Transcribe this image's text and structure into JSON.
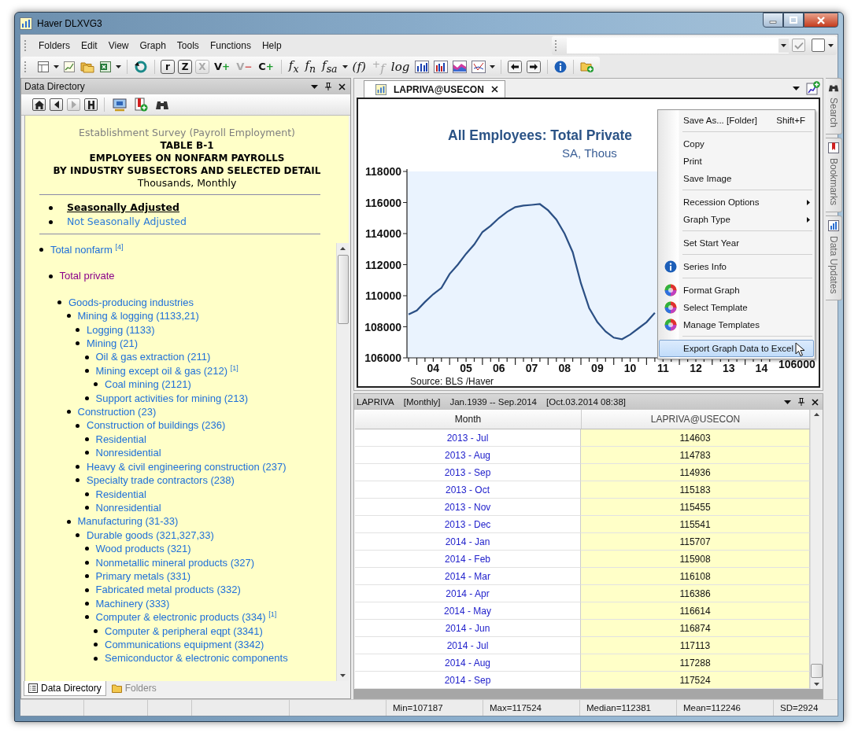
{
  "window": {
    "title": "Haver DLXVG3"
  },
  "menu": [
    "Folders",
    "Edit",
    "View",
    "Graph",
    "Tools",
    "Functions",
    "Help"
  ],
  "toolbar": {
    "glyph_buttons": [
      {
        "kind": "boxed",
        "label": "r",
        "disabled": false,
        "dropdown": false
      },
      {
        "kind": "boxed",
        "label": "Z",
        "disabled": false,
        "dropdown": false
      },
      {
        "kind": "boxed",
        "label": "X",
        "disabled": true,
        "dropdown": false
      },
      {
        "kind": "sign",
        "label": "V",
        "sign": "+",
        "disabled": false,
        "dropdown": false
      },
      {
        "kind": "sign",
        "label": "V",
        "sign": "−",
        "disabled": true,
        "dropdown": false
      },
      {
        "kind": "sign",
        "label": "C",
        "sign": "+",
        "disabled": false,
        "dropdown": false
      },
      {
        "kind": "italic",
        "label": "f$_{x}$",
        "disabled": false,
        "dropdown": false
      },
      {
        "kind": "italic",
        "label": "f$_{n}$",
        "disabled": false,
        "dropdown": false
      },
      {
        "kind": "italic",
        "label": "f$_{sa}$",
        "disabled": false,
        "dropdown": true
      },
      {
        "kind": "italic",
        "label": "(f)",
        "disabled": false,
        "dropdown": false
      },
      {
        "kind": "italic",
        "label": "$^{+}$f",
        "disabled": true,
        "dropdown": false
      },
      {
        "kind": "italic",
        "label": "log",
        "disabled": false,
        "dropdown": false
      }
    ]
  },
  "left_panel": {
    "title": "Data Directory",
    "heading": {
      "survey": "Establishment Survey (Payroll Employment)",
      "table": "TABLE B-1",
      "lines": [
        "EMPLOYEES ON NONFARM PAYROLLS",
        "BY INDUSTRY SUBSECTORS AND SELECTED DETAIL"
      ],
      "units": "Thousands, Monthly"
    },
    "adjustment_links": [
      {
        "label": "Seasonally Adjusted",
        "selected": true
      },
      {
        "label": "Not Seasonally Adjusted",
        "selected": false
      }
    ],
    "tree": [
      {
        "label": "Total nonfarm $^{[4]}$",
        "visited": false,
        "children": [
          {
            "label": "Total private",
            "visited": true,
            "children": [
              {
                "label": "Goods-producing industries",
                "visited": false,
                "children": [
                  {
                    "label": "Mining & logging (1133,21)",
                    "visited": false,
                    "children": [
                      {
                        "label": "Logging (1133)",
                        "visited": false
                      },
                      {
                        "label": "Mining (21)",
                        "visited": false,
                        "children": [
                          {
                            "label": "Oil & gas extraction (211)",
                            "visited": false
                          },
                          {
                            "label": "Mining except oil & gas (212) $^{[1]}$",
                            "visited": false,
                            "children": [
                              {
                                "label": "Coal mining (2121)",
                                "visited": false
                              }
                            ]
                          },
                          {
                            "label": "Support activities for mining (213)",
                            "visited": false
                          }
                        ]
                      }
                    ]
                  },
                  {
                    "label": "Construction (23)",
                    "visited": false,
                    "children": [
                      {
                        "label": "Construction of buildings (236)",
                        "visited": false,
                        "children": [
                          {
                            "label": "Residential",
                            "visited": false
                          },
                          {
                            "label": "Nonresidential",
                            "visited": false
                          }
                        ]
                      },
                      {
                        "label": "Heavy & civil engineering construction (237)",
                        "visited": false
                      },
                      {
                        "label": "Specialty trade contractors (238)",
                        "visited": false,
                        "children": [
                          {
                            "label": "Residential",
                            "visited": false
                          },
                          {
                            "label": "Nonresidential",
                            "visited": false
                          }
                        ]
                      }
                    ]
                  },
                  {
                    "label": "Manufacturing (31-33)",
                    "visited": false,
                    "children": [
                      {
                        "label": "Durable goods (321,327,33)",
                        "visited": false,
                        "children": [
                          {
                            "label": "Wood products (321)",
                            "visited": false
                          },
                          {
                            "label": "Nonmetallic mineral products (327)",
                            "visited": false
                          },
                          {
                            "label": "Primary metals (331)",
                            "visited": false
                          },
                          {
                            "label": "Fabricated metal products (332)",
                            "visited": false
                          },
                          {
                            "label": "Machinery (333)",
                            "visited": false
                          },
                          {
                            "label": "Computer & electronic products (334) $^{[1]}$",
                            "visited": false,
                            "children": [
                              {
                                "label": "Computer & peripheral eqpt (3341)",
                                "visited": false
                              },
                              {
                                "label": "Communications equipment (3342)",
                                "visited": false
                              },
                              {
                                "label": "Semiconductor & electronic components",
                                "visited": false
                              }
                            ]
                          }
                        ]
                      }
                    ]
                  }
                ]
              }
            ]
          }
        ]
      }
    ],
    "bottom_tabs": [
      {
        "label": "Data Directory",
        "selected": true
      },
      {
        "label": "Folders",
        "selected": false
      }
    ]
  },
  "graph_panel": {
    "tab": "LAPRIVA@USECON",
    "title": "All Employees: Total Private",
    "subtitle": "SA, Thous",
    "source": "Source: BLS /Haver",
    "right_ytick": "106000",
    "chart_data": {
      "type": "line",
      "x": [
        3.25,
        3.5,
        3.75,
        4.0,
        4.25,
        4.5,
        4.75,
        5.0,
        5.25,
        5.5,
        5.75,
        6.0,
        6.25,
        6.5,
        6.75,
        7.0,
        7.25,
        7.5,
        7.75,
        8.0,
        8.25,
        8.5,
        8.75,
        9.0,
        9.25,
        9.5,
        9.75,
        10.0,
        10.25,
        10.5,
        10.75
      ],
      "series": [
        {
          "color": "#2b4f84",
          "values": [
            108800,
            109050,
            109600,
            110100,
            110500,
            111400,
            112000,
            112700,
            113300,
            114100,
            114500,
            115000,
            115400,
            115700,
            115800,
            115850,
            115900,
            115500,
            114900,
            114000,
            112800,
            110800,
            109200,
            108300,
            107700,
            107300,
            107200,
            107500,
            107900,
            108300,
            108900
          ]
        }
      ],
      "xlim": [
        3.2,
        14.35
      ],
      "ylim": [
        106000,
        118000
      ],
      "xticks": [
        {
          "value": 4,
          "label": "04"
        },
        {
          "value": 5,
          "label": "05"
        },
        {
          "value": 6,
          "label": "06"
        },
        {
          "value": 7,
          "label": "07"
        },
        {
          "value": 8,
          "label": "08"
        },
        {
          "value": 9,
          "label": "09"
        },
        {
          "value": 10,
          "label": "10"
        },
        {
          "value": 11,
          "label": "11"
        },
        {
          "value": 12,
          "label": "12"
        },
        {
          "value": 13,
          "label": "13"
        },
        {
          "value": 14,
          "label": "14"
        }
      ],
      "yticks": [
        106000,
        108000,
        110000,
        112000,
        114000,
        116000,
        118000
      ]
    }
  },
  "context_menu": [
    {
      "kind": "plain",
      "label": "Save As... [Folder]",
      "shortcut": "Shift+F",
      "submenu": false,
      "selected": false
    },
    {
      "kind": "separator"
    },
    {
      "kind": "plain",
      "label": "Copy",
      "submenu": false,
      "selected": false
    },
    {
      "kind": "plain",
      "label": "Print",
      "submenu": false,
      "selected": false
    },
    {
      "kind": "plain",
      "label": "Save Image",
      "submenu": false,
      "selected": false
    },
    {
      "kind": "separator"
    },
    {
      "kind": "plain",
      "label": "Recession Options",
      "submenu": true,
      "selected": false
    },
    {
      "kind": "plain",
      "label": "Graph Type",
      "submenu": true,
      "selected": false
    },
    {
      "kind": "separator"
    },
    {
      "kind": "plain",
      "label": "Set Start Year",
      "submenu": false,
      "selected": false
    },
    {
      "kind": "separator"
    },
    {
      "kind": "info",
      "label": "Series Info",
      "submenu": false,
      "selected": false
    },
    {
      "kind": "separator"
    },
    {
      "kind": "palette",
      "label": "Format Graph",
      "submenu": false,
      "selected": false
    },
    {
      "kind": "palette",
      "label": "Select Template",
      "submenu": false,
      "selected": false
    },
    {
      "kind": "palette",
      "label": "Manage Templates",
      "submenu": false,
      "selected": false
    },
    {
      "kind": "separator"
    },
    {
      "kind": "plain",
      "label": "Export Graph Data to Excel",
      "submenu": false,
      "selected": true
    }
  ],
  "table_panel": {
    "header": {
      "series": "LAPRIVA",
      "frequency": "[Monthly]",
      "range": "Jan.1939 -- Sep.2014",
      "updated": "[Oct.03.2014 08:38]"
    },
    "columns": [
      "Month",
      "LAPRIVA@USECON"
    ],
    "rows": [
      [
        "2013 - Jul",
        "114603"
      ],
      [
        "2013 - Aug",
        "114783"
      ],
      [
        "2013 - Sep",
        "114936"
      ],
      [
        "2013 - Oct",
        "115183"
      ],
      [
        "2013 - Nov",
        "115455"
      ],
      [
        "2013 - Dec",
        "115541"
      ],
      [
        "2014 - Jan",
        "115707"
      ],
      [
        "2014 - Feb",
        "115908"
      ],
      [
        "2014 - Mar",
        "116108"
      ],
      [
        "2014 - Apr",
        "116386"
      ],
      [
        "2014 - May",
        "116614"
      ],
      [
        "2014 - Jun",
        "116874"
      ],
      [
        "2014 - Jul",
        "117113"
      ],
      [
        "2014 - Aug",
        "117288"
      ],
      [
        "2014 - Sep",
        "117524"
      ]
    ]
  },
  "side_tabs": [
    "Search",
    "Bookmarks",
    "Data Updates"
  ],
  "status_bar": [
    "Min=107187",
    "Max=117524",
    "Median=112381",
    "Mean=112246",
    "SD=2924"
  ]
}
